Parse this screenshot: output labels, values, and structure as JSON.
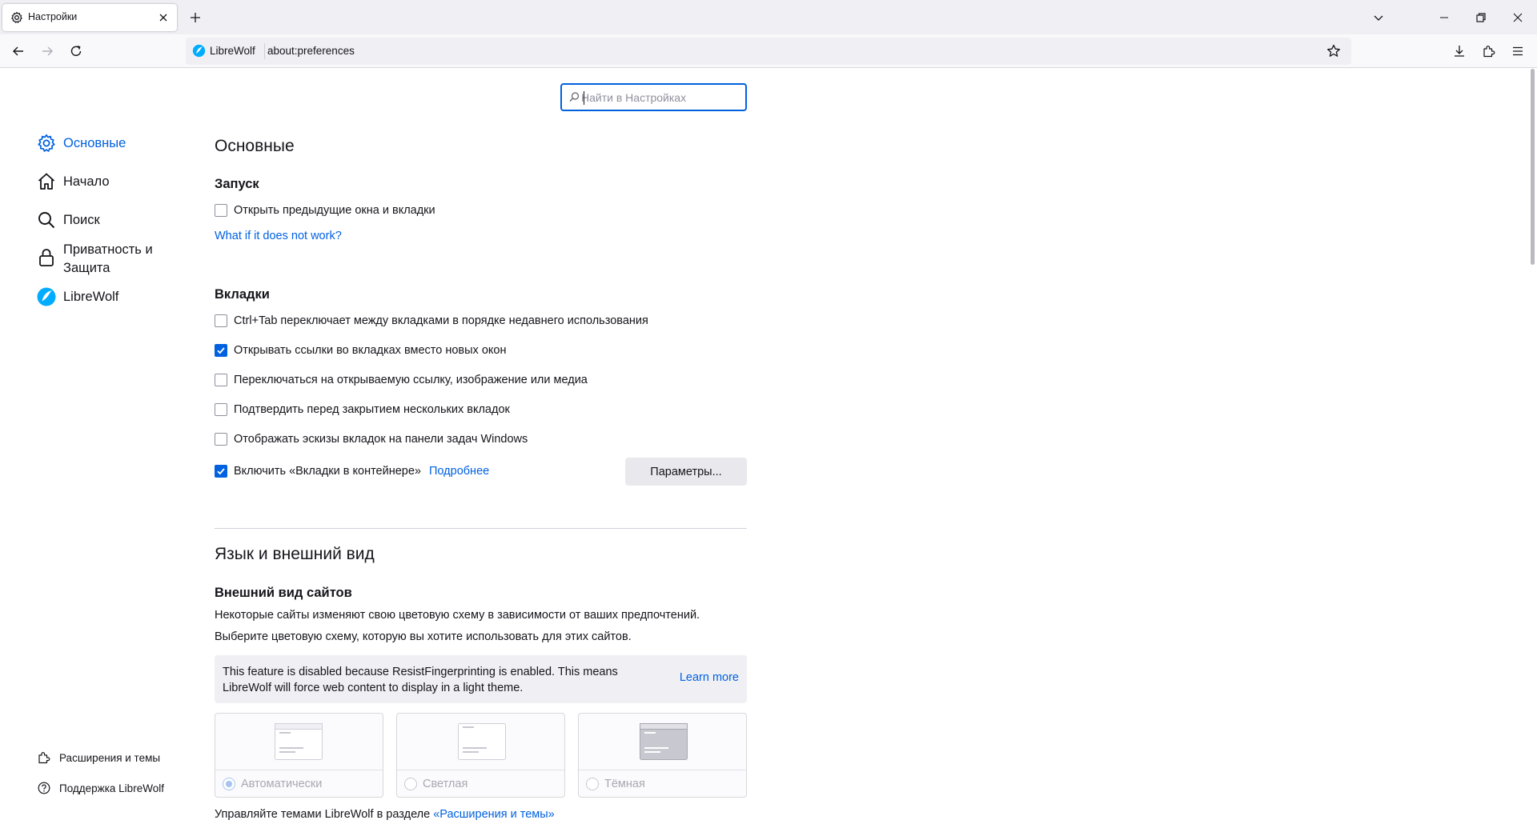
{
  "tab": {
    "title": "Настройки"
  },
  "urlbar": {
    "identity": "LibreWolf",
    "url": "about:preferences"
  },
  "search": {
    "placeholder": "Найти в Настройках",
    "value": ""
  },
  "sidebar": {
    "items": [
      {
        "label": "Основные",
        "icon": "gear-icon",
        "selected": true
      },
      {
        "label": "Начало",
        "icon": "home-icon"
      },
      {
        "label": "Поиск",
        "icon": "search-icon"
      },
      {
        "label": "Приватность и Защита",
        "icon": "lock-icon"
      },
      {
        "label": "LibreWolf",
        "icon": "librewolf-icon"
      }
    ],
    "footer": [
      {
        "label": "Расширения и темы",
        "icon": "puzzle-icon"
      },
      {
        "label": "Поддержка LibreWolf",
        "icon": "help-icon"
      }
    ]
  },
  "general": {
    "title": "Основные",
    "startup": {
      "heading": "Запуск",
      "restore_session": {
        "label": "Открыть предыдущие окна и вкладки",
        "checked": false
      },
      "help_link": "What if it does not work?"
    },
    "tabs": {
      "heading": "Вкладки",
      "options": [
        {
          "label": "Ctrl+Tab переключает между вкладками в порядке недавнего использования",
          "checked": false
        },
        {
          "label": "Открывать ссылки во вкладках вместо новых окон",
          "checked": true
        },
        {
          "label": "Переключаться на открываемую ссылку, изображение или медиа",
          "checked": false
        },
        {
          "label": "Подтвердить перед закрытием нескольких вкладок",
          "checked": false
        },
        {
          "label": "Отображать эскизы вкладок на панели задач Windows",
          "checked": false
        }
      ],
      "containers": {
        "label": "Включить «Вкладки в контейнере»",
        "checked": true,
        "learn_more": "Подробнее",
        "button": "Параметры..."
      }
    }
  },
  "appearance": {
    "title": "Язык и внешний вид",
    "heading": "Внешний вид сайтов",
    "desc1": "Некоторые сайты изменяют свою цветовую схему в зависимости от ваших предпочтений.",
    "desc2": "Выберите цветовую схему, которую вы хотите использовать для этих сайтов.",
    "notice": "This feature is disabled because ResistFingerprinting is enabled. This means LibreWolf will force web content to display in a light theme.",
    "notice_link": "Learn more",
    "schemes": [
      {
        "label": "Автоматически",
        "selected": true
      },
      {
        "label": "Светлая",
        "selected": false
      },
      {
        "label": "Тёмная",
        "selected": false
      }
    ],
    "manage_text": "Управляйте темами LibreWolf в разделе ",
    "manage_link": "«Расширения и темы»"
  }
}
